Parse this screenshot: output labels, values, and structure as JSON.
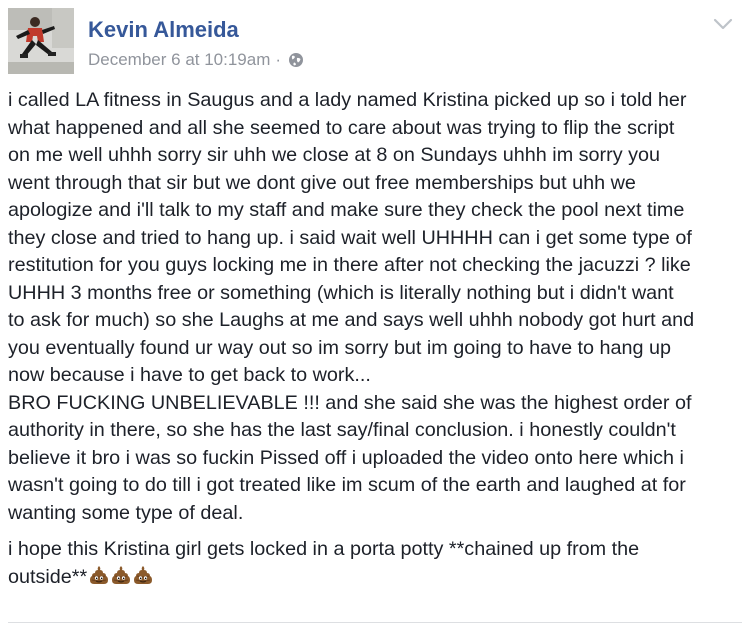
{
  "post": {
    "author_name": "Kevin Almeida",
    "timestamp": "December 6 at 10:19am",
    "separator": "·",
    "privacy_icon": "globe-icon",
    "menu_icon": "chevron-down-icon",
    "paragraph_1": "i called LA fitness in Saugus and a lady named Kristina picked up so i told her\nwhat happened and all she seemed to care about was trying to flip the script\non me well uhhh sorry sir uhh we close at 8 on Sundays uhhh im sorry you\nwent through that sir but we dont give out free memberships but uhh we\napologize and i'll talk to my staff and make sure they check the pool next time\nthey close and tried to hang up. i said wait well UHHHH can i get some type of\nrestitution for you guys locking me in there after not checking the jacuzzi ? like\nUHHH 3 months free or something (which is literally nothing but i didn't want\nto ask for much) so she Laughs at me and says well uhhh nobody got hurt and\nyou eventually found ur way out so im sorry but im going to have to hang up\nnow because i have to get back to work...\nBRO FUCKING UNBELIEVABLE !!! and she said she was the highest order of\nauthority in there, so she has the last say/final conclusion. i honestly couldn't\nbelieve it bro i was so fuckin Pissed off i uploaded the video onto here which i\nwasn't going to do till i got treated like im scum of the earth and laughed at for\nwanting some type of deal.",
    "paragraph_2": "i hope this Kristina girl gets locked in a porta potty **chained up from the\noutside**",
    "emoji_icon": "pile-of-poo-icon",
    "emoji_count": 3,
    "colors": {
      "author_link": "#365899",
      "meta_text": "#90949c",
      "body_text": "#1d2129",
      "divider": "#dddfe2"
    }
  }
}
